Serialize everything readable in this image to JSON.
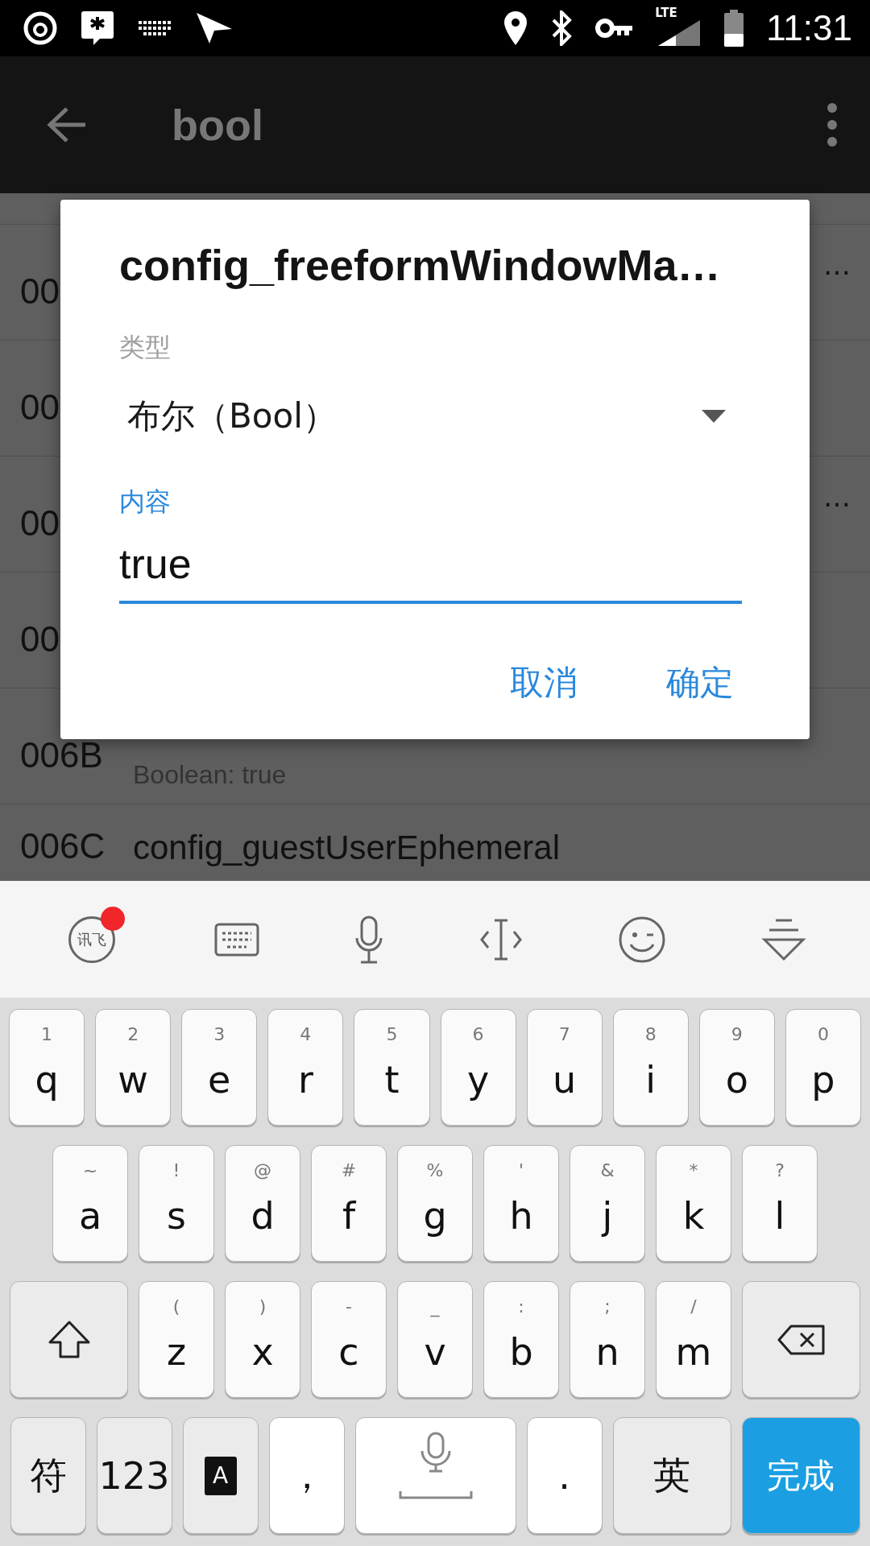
{
  "status_bar": {
    "network": "LTE",
    "time": "11:31"
  },
  "app_bar": {
    "title": "bool"
  },
  "list": {
    "rows": [
      {
        "index": "00",
        "trailing": "…"
      },
      {
        "index": "00"
      },
      {
        "index": "00",
        "trailing": "…"
      },
      {
        "index": "00"
      },
      {
        "index": "006B",
        "subtitle": "Boolean: true"
      },
      {
        "index": "006C",
        "title": "config_guestUserEphemeral"
      }
    ]
  },
  "dialog": {
    "title": "config_freeformWindowMa…",
    "type_label": "类型",
    "type_value": "布尔（Bool）",
    "content_label": "内容",
    "content_value": "true",
    "buttons": [
      "取消",
      "确定"
    ]
  },
  "keyboard": {
    "toolbar": [
      {
        "kind": "logo",
        "label": "讯飞",
        "badge": true
      },
      {
        "kind": "keyboard"
      },
      {
        "kind": "mic"
      },
      {
        "kind": "cursor"
      },
      {
        "kind": "emoji"
      },
      {
        "kind": "collapse"
      }
    ],
    "rows": [
      {
        "keys": [
          {
            "kind": "letter",
            "label": "q",
            "hint": "1"
          },
          {
            "kind": "letter",
            "label": "w",
            "hint": "2"
          },
          {
            "kind": "letter",
            "label": "e",
            "hint": "3"
          },
          {
            "kind": "letter",
            "label": "r",
            "hint": "4"
          },
          {
            "kind": "letter",
            "label": "t",
            "hint": "5"
          },
          {
            "kind": "letter",
            "label": "y",
            "hint": "6"
          },
          {
            "kind": "letter",
            "label": "u",
            "hint": "7"
          },
          {
            "kind": "letter",
            "label": "i",
            "hint": "8"
          },
          {
            "kind": "letter",
            "label": "o",
            "hint": "9"
          },
          {
            "kind": "letter",
            "label": "p",
            "hint": "0"
          }
        ]
      },
      {
        "keys": [
          {
            "kind": "letter",
            "label": "a",
            "hint": "~"
          },
          {
            "kind": "letter",
            "label": "s",
            "hint": "!"
          },
          {
            "kind": "letter",
            "label": "d",
            "hint": "@"
          },
          {
            "kind": "letter",
            "label": "f",
            "hint": "#"
          },
          {
            "kind": "letter",
            "label": "g",
            "hint": "%"
          },
          {
            "kind": "letter",
            "label": "h",
            "hint": "'"
          },
          {
            "kind": "letter",
            "label": "j",
            "hint": "&"
          },
          {
            "kind": "letter",
            "label": "k",
            "hint": "*"
          },
          {
            "kind": "letter",
            "label": "l",
            "hint": "?"
          }
        ]
      },
      {
        "keys": [
          {
            "kind": "shift"
          },
          {
            "kind": "letter",
            "label": "z",
            "hint": "("
          },
          {
            "kind": "letter",
            "label": "x",
            "hint": ")"
          },
          {
            "kind": "letter",
            "label": "c",
            "hint": "-"
          },
          {
            "kind": "letter",
            "label": "v",
            "hint": "_"
          },
          {
            "kind": "letter",
            "label": "b",
            "hint": ":"
          },
          {
            "kind": "letter",
            "label": "n",
            "hint": ";"
          },
          {
            "kind": "letter",
            "label": "m",
            "hint": "/"
          },
          {
            "kind": "backspace"
          }
        ]
      },
      {
        "keys": [
          {
            "kind": "function",
            "label": "符"
          },
          {
            "kind": "function",
            "label": "123"
          },
          {
            "kind": "dictionary",
            "label": "A"
          },
          {
            "kind": "punct",
            "label": "，"
          },
          {
            "kind": "space"
          },
          {
            "kind": "punct",
            "label": "."
          },
          {
            "kind": "wide",
            "label": "英"
          },
          {
            "kind": "action",
            "label": "完成"
          }
        ]
      }
    ]
  }
}
